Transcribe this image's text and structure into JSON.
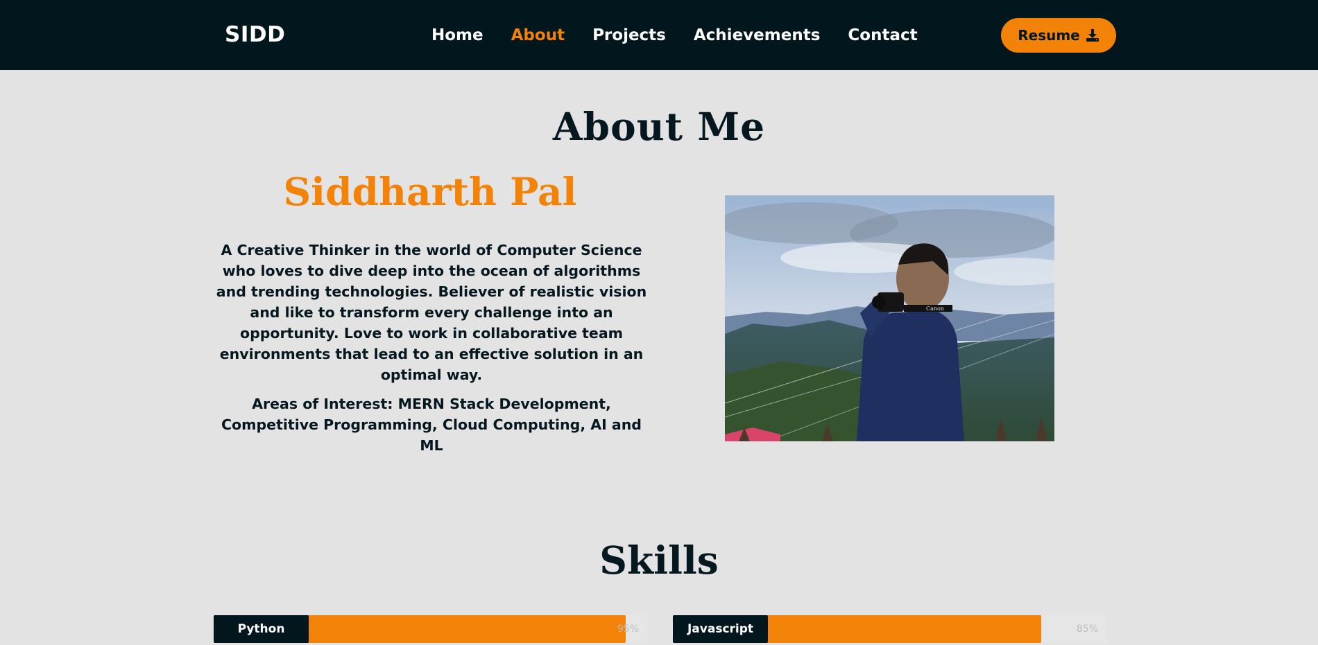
{
  "navbar": {
    "brand": "SIDD",
    "links": [
      {
        "label": "Home",
        "active": false
      },
      {
        "label": "About",
        "active": true
      },
      {
        "label": "Projects",
        "active": false
      },
      {
        "label": "Achievements",
        "active": false
      },
      {
        "label": "Contact",
        "active": false
      }
    ],
    "resume_label": "Resume",
    "resume_icon": "download-icon"
  },
  "about": {
    "heading": "About Me",
    "name": "Siddharth Pal",
    "bio": "A Creative Thinker in the world of Computer Science who loves to dive deep into the ocean of algorithms and trending technologies. Believer of realistic vision and like to transform every challenge into an opportunity. Love to work in collaborative team environments that lead to an effective solution in an optimal way.",
    "interests": "Areas of Interest: MERN Stack Development, Competitive Programming, Cloud Computing, AI and ML",
    "photo_camera_text": "Canon"
  },
  "skills": {
    "heading": "Skills",
    "items": [
      {
        "label": "Python",
        "percent_text": "95%",
        "level": 0.95
      },
      {
        "label": "Javascript",
        "percent_text": "85%",
        "level": 0.85
      }
    ]
  },
  "colors": {
    "accent": "#f28308",
    "dark": "#02161d",
    "background": "#e3e3e3"
  }
}
